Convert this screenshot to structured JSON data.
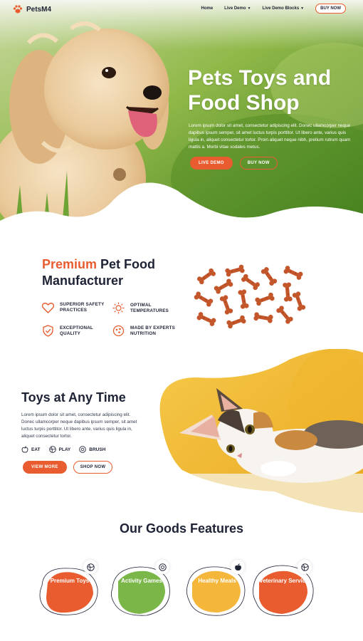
{
  "nav": {
    "logo_text": "PetsM4",
    "links": [
      "Home",
      "Live Demo",
      "Live Demo Blocks"
    ],
    "cta": "BUY NOW"
  },
  "hero": {
    "title": "Pets Toys and Food Shop",
    "text": "Lorem ipsum dolor sit amet, consectetur adipiscing elit. Donec ullamcorper neque dapibus ipsum semper, sit amet luctus turpis porttitor. Ut libero ante, varius quis ligula in, aliquet consectetur tortor. Proin aliquet neque nibh, pretium rutrum quam mattis a. Morbi vitae sodales metus.",
    "primary_button": "LIVE DEMO",
    "secondary_button": "BUY NOW"
  },
  "premium": {
    "title_accent": "Premium",
    "title_rest": " Pet Food Manufacturer",
    "features": [
      {
        "label": "SUPERIOR SAFETY PRACTICES",
        "icon": "heart-icon"
      },
      {
        "label": "OPTIMAL TEMPERATURES",
        "icon": "sun-icon"
      },
      {
        "label": "EXCEPTIONAL QUALITY",
        "icon": "shield-check-icon"
      },
      {
        "label": "MADE BY EXPERTS NUTRITION",
        "icon": "food-bowl-icon"
      }
    ]
  },
  "toys": {
    "title": "Toys at Any Time",
    "text": "Lorem ipsum dolor sit amet, consectetur adipiscing elit. Donec ullamcorper neque dapibus ipsum semper, sit amet luctus turpis porttitor. Ut libero ante, varius quis ligula in, aliquet consectetur tortor.",
    "tags": [
      {
        "label": "EAT",
        "icon": "apple-icon"
      },
      {
        "label": "PLAY",
        "icon": "ball-icon"
      },
      {
        "label": "BRUSH",
        "icon": "brush-icon"
      }
    ],
    "primary_button": "VIEW MORE",
    "secondary_button": "SHOP NOW"
  },
  "goods": {
    "title": "Our Goods Features",
    "cards": [
      {
        "label": "Premium Toys",
        "color": "#e85c2f",
        "icon": "ball-icon"
      },
      {
        "label": "Activity Games",
        "color": "#7ab648",
        "icon": "brush-icon"
      },
      {
        "label": "Healthy Meals",
        "color": "#f5b73b",
        "icon": "apple-icon"
      },
      {
        "label": "Veterinary Service",
        "color": "#e85c2f",
        "icon": "ball-icon"
      }
    ]
  },
  "colors": {
    "accent": "#e85c2f",
    "dark": "#1e2235",
    "green": "#7ab648",
    "yellow": "#f5b73b"
  }
}
